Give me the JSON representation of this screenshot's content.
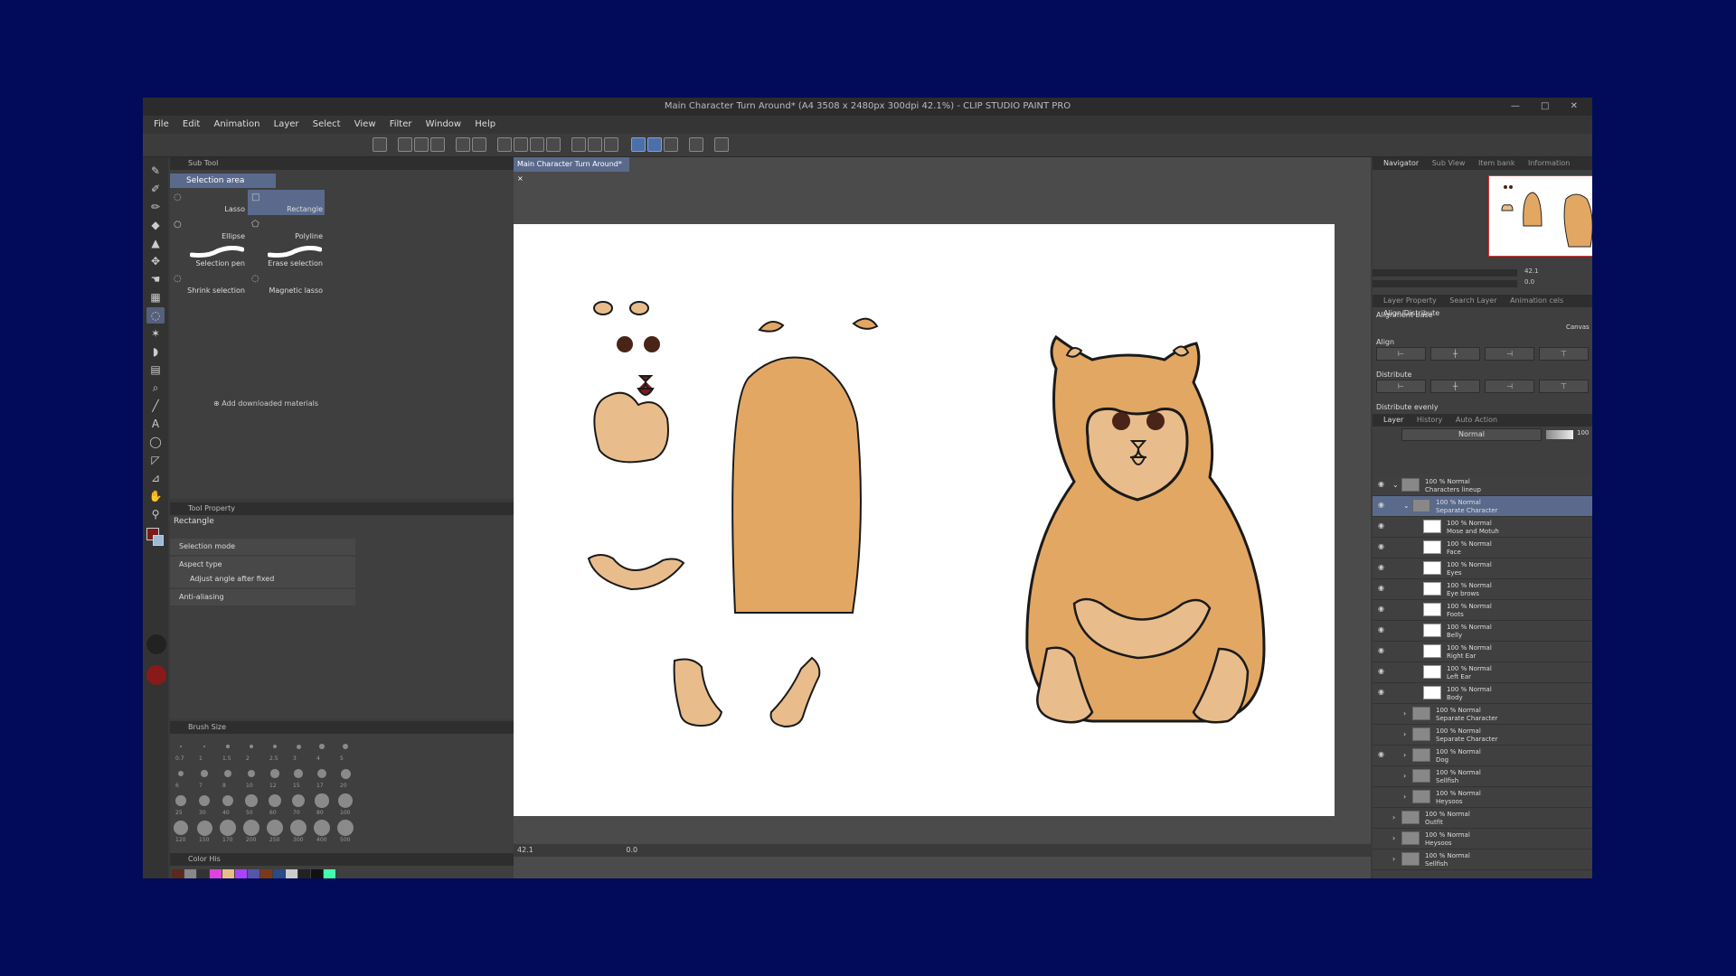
{
  "window": {
    "title": "Main Character Turn Around* (A4 3508 x 2480px 300dpi 42.1%) - CLIP STUDIO PAINT PRO",
    "controls": "— □ ✕"
  },
  "menu": [
    "File",
    "Edit",
    "Animation",
    "Layer",
    "Select",
    "View",
    "Filter",
    "Window",
    "Help"
  ],
  "subtool": {
    "tab_label": "Sub Tool",
    "group_label": "Selection area",
    "items": [
      "Lasso",
      "Rectangle",
      "Ellipse",
      "Polyline",
      "Selection pen",
      "Erase selection",
      "Shrink selection",
      "Magnetic lasso"
    ],
    "add_materials": "Add downloaded materials"
  },
  "tool_property": {
    "tab_label": "Tool Property",
    "tool_name": "Rectangle",
    "rows": [
      "Selection mode",
      "Aspect type",
      "Adjust angle after fixed",
      "Anti-aliasing"
    ]
  },
  "brush_size": {
    "tab_label": "Brush Size",
    "sizes": [
      "0.7",
      "1",
      "1.5",
      "2",
      "2.5",
      "3",
      "4",
      "5",
      "6",
      "7",
      "8",
      "10",
      "12",
      "15",
      "17",
      "20",
      "25",
      "30",
      "40",
      "50",
      "60",
      "70",
      "80",
      "100",
      "120",
      "150",
      "170",
      "200",
      "250",
      "300",
      "400",
      "500"
    ]
  },
  "color_hist": {
    "tab_label": "Color His"
  },
  "canvas": {
    "doc_tab": "Main Character Turn Around*",
    "zoom": "42.1",
    "angle": "0.0"
  },
  "navigator": {
    "tabs": [
      "Navigator",
      "Sub View",
      "Item bank",
      "Information"
    ],
    "zoom": "42.1",
    "angle": "0.0"
  },
  "align": {
    "tabs": [
      "Layer Property",
      "Search Layer",
      "Animation cels",
      "Align/Distribute"
    ],
    "alignment_base": "Alignment base",
    "canvas_label": "Canvas",
    "align_label": "Align",
    "distribute_label": "Distribute",
    "distribute_evenly_label": "Distribute evenly"
  },
  "layer_panel": {
    "tabs": [
      "Layer",
      "History",
      "Auto Action"
    ],
    "blend_mode": "Normal",
    "opacity": "100",
    "layers": [
      {
        "opacity": "100 % Normal",
        "name": "Characters lineup",
        "indent": 0,
        "type": "folder",
        "visible": true
      },
      {
        "opacity": "100 % Normal",
        "name": "Separate Character",
        "indent": 1,
        "type": "folder",
        "visible": true
      },
      {
        "opacity": "100 % Normal",
        "name": "Mose and Motuh",
        "indent": 2,
        "type": "layer",
        "visible": true
      },
      {
        "opacity": "100 % Normal",
        "name": "Face",
        "indent": 2,
        "type": "layer",
        "visible": true
      },
      {
        "opacity": "100 % Normal",
        "name": "Eyes",
        "indent": 2,
        "type": "layer",
        "visible": true
      },
      {
        "opacity": "100 % Normal",
        "name": "Eye brows",
        "indent": 2,
        "type": "layer",
        "visible": true
      },
      {
        "opacity": "100 % Normal",
        "name": "Foots",
        "indent": 2,
        "type": "layer",
        "visible": true
      },
      {
        "opacity": "100 % Normal",
        "name": "Belly",
        "indent": 2,
        "type": "layer",
        "visible": true
      },
      {
        "opacity": "100 % Normal",
        "name": "Right Ear",
        "indent": 2,
        "type": "layer",
        "visible": true
      },
      {
        "opacity": "100 % Normal",
        "name": "Left Ear",
        "indent": 2,
        "type": "layer",
        "visible": true
      },
      {
        "opacity": "100 % Normal",
        "name": "Body",
        "indent": 2,
        "type": "layer",
        "visible": true
      },
      {
        "opacity": "100 % Normal",
        "name": "Separate Character",
        "indent": 1,
        "type": "folder",
        "visible": false
      },
      {
        "opacity": "100 % Normal",
        "name": "Separate Character",
        "indent": 1,
        "type": "folder",
        "visible": false
      },
      {
        "opacity": "100 % Normal",
        "name": "Dog",
        "indent": 1,
        "type": "folder",
        "visible": true
      },
      {
        "opacity": "100 % Normal",
        "name": "Sellfish",
        "indent": 1,
        "type": "folder",
        "visible": false
      },
      {
        "opacity": "100 % Normal",
        "name": "Heysoos",
        "indent": 1,
        "type": "folder",
        "visible": false
      },
      {
        "opacity": "100 % Normal",
        "name": "Outfit",
        "indent": 0,
        "type": "folder",
        "visible": false
      },
      {
        "opacity": "100 % Normal",
        "name": "Heysoos",
        "indent": 0,
        "type": "folder",
        "visible": false
      },
      {
        "opacity": "100 % Normal",
        "name": "Sellfish",
        "indent": 0,
        "type": "folder",
        "visible": false
      }
    ]
  },
  "colors": {
    "dog_body": "#e3a764",
    "dog_light": "#e8bd8b",
    "outline": "#1a1a1a",
    "selection_blue": "#5a6a8c"
  }
}
